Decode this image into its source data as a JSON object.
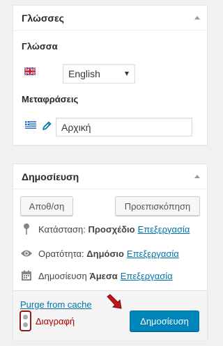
{
  "languages_box": {
    "title": "Γλώσσες",
    "language_label": "Γλώσσα",
    "selected_language": "English",
    "translations_label": "Μεταφράσεις",
    "translation_value": "Αρχική"
  },
  "publish_box": {
    "title": "Δημοσίευση",
    "save_draft_label": "Αποθ/ση",
    "preview_label": "Προεπισκόπηση",
    "status_label": "Κατάσταση:",
    "status_value": "Προσχέδιο",
    "visibility_label": "Ορατότητα:",
    "visibility_value": "Δημόσιο",
    "publish_time_label": "Δημοσίευση",
    "publish_time_value": "Άμεσα",
    "edit_label": "Επεξεργασία",
    "purge_cache_label": "Purge from cache",
    "delete_label": "Διαγραφή",
    "publish_label": "Δημοσίευση"
  },
  "icons": [
    "uk-flag-icon",
    "greek-flag-icon",
    "pencil-icon",
    "pin-icon",
    "eye-icon",
    "calendar-icon",
    "toggle-up-icon",
    "red-arrow-icon"
  ],
  "colors": {
    "link": "#0073aa",
    "primary_button": "#0085ba",
    "delete": "#aa0000",
    "arrow": "#c0161a"
  }
}
